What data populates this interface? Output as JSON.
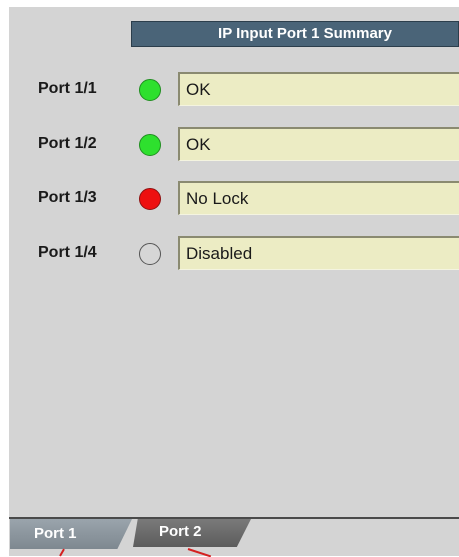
{
  "summary": {
    "title": "IP Input Port 1 Summary"
  },
  "ports": [
    {
      "label": "Port 1/1",
      "status": "OK",
      "indicator": "green"
    },
    {
      "label": "Port 1/2",
      "status": "OK",
      "indicator": "green"
    },
    {
      "label": "Port 1/3",
      "status": "No Lock",
      "indicator": "red"
    },
    {
      "label": "Port 1/4",
      "status": "Disabled",
      "indicator": "off"
    }
  ],
  "tabs": [
    {
      "label": "Port 1",
      "selected": true
    },
    {
      "label": "Port 2",
      "selected": false
    }
  ],
  "colors": {
    "green": "#2ee02e",
    "red": "#ee1010",
    "off": "#d6d6d6",
    "header": "#4a6478",
    "field": "#ececc4"
  }
}
